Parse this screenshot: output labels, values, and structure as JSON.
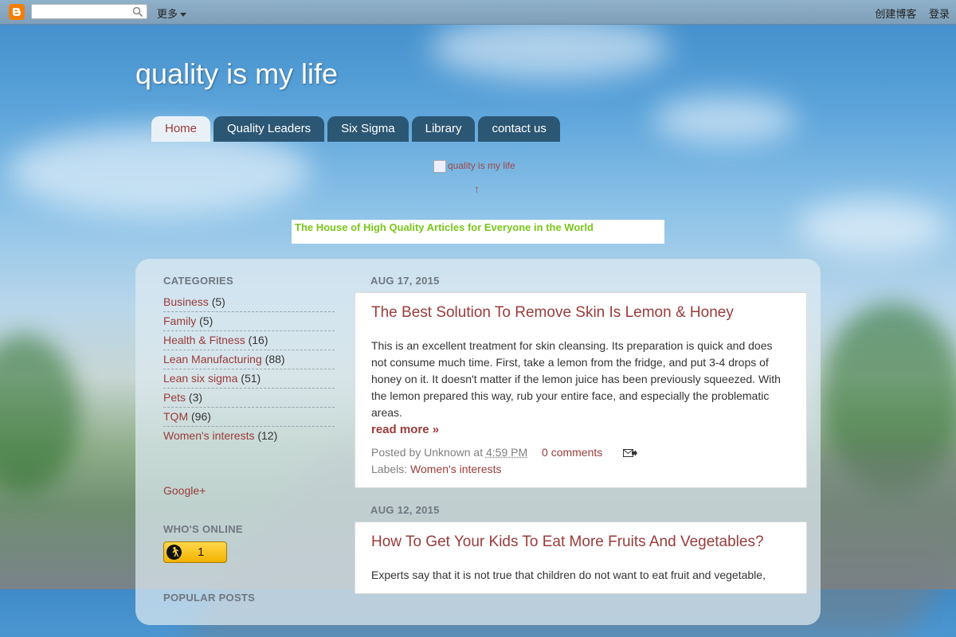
{
  "navbar": {
    "search_placeholder": "",
    "more_label": "更多",
    "create_blog": "创建博客",
    "sign_in": "登录"
  },
  "header": {
    "title": "quality is my life",
    "image_alt": "quality is my life",
    "arrow": "↑",
    "tagline": "The House of High Quality Articles for Everyone in the World"
  },
  "tabs": [
    {
      "label": "Home",
      "active": true
    },
    {
      "label": "Quality Leaders"
    },
    {
      "label": "Six Sigma"
    },
    {
      "label": "Library"
    },
    {
      "label": "contact us"
    }
  ],
  "sidebar": {
    "categories_title": "CATEGORIES",
    "categories": [
      {
        "name": "Business",
        "count": "(5)"
      },
      {
        "name": "Family",
        "count": "(5)"
      },
      {
        "name": "Health & Fitness",
        "count": "(16)"
      },
      {
        "name": "Lean Manufacturing",
        "count": "(88)"
      },
      {
        "name": "Lean six sigma",
        "count": "(51)"
      },
      {
        "name": "Pets",
        "count": "(3)"
      },
      {
        "name": "TQM",
        "count": "(96)"
      },
      {
        "name": "Women's interests",
        "count": "(12)"
      }
    ],
    "google_plus": "Google+",
    "whos_online_title": "WHO'S ONLINE",
    "online_count": "1",
    "popular_posts_title": "POPULAR POSTS"
  },
  "posts": [
    {
      "date": "AUG 17, 2015",
      "title": "The Best Solution To Remove Skin Is Lemon & Honey",
      "body": "This is an excellent treatment for skin cleansing. Its preparation is quick and does not consume much time. First, take a lemon from the fridge, and put 3-4 drops of honey on it. It doesn't matter if the lemon juice has been previously squeezed. With the lemon prepared this way, rub your entire face, and especially the problematic areas.",
      "read_more": "read more »",
      "posted_by": "Posted by Unknown at",
      "time": "4:59 PM",
      "comments": "0 comments",
      "labels_prefix": "Labels:",
      "label": "Women's interests"
    },
    {
      "date": "AUG 12, 2015",
      "title": "How To Get Your Kids To Eat More Fruits And Vegetables?",
      "body": "Experts say that it is not true that children do not want to eat fruit and vegetable,"
    }
  ],
  "colors": {
    "accent_link": "#9a3b3b",
    "tab_bg": "#2c5774",
    "tagline_green": "#7ac61b",
    "blogger_orange": "#f57d00"
  }
}
